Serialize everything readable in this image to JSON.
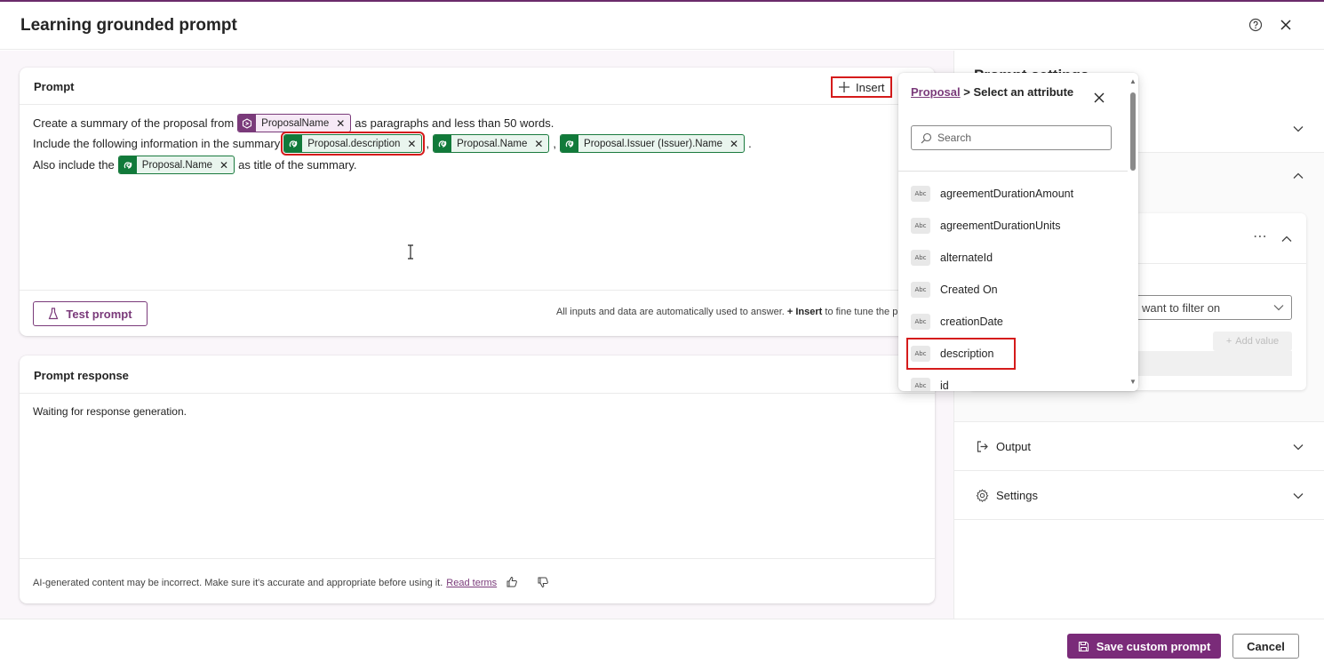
{
  "dialog": {
    "title": "Learning grounded prompt",
    "help_icon": "help-icon",
    "close_icon": "close-icon"
  },
  "prompt": {
    "section_title": "Prompt",
    "insert_label": "Insert",
    "line1": {
      "before": "Create a summary of the proposal from",
      "chip": "ProposalName",
      "after": "as paragraphs and less than 50 words."
    },
    "line2": {
      "before": "Include the following information in the summary",
      "chips": [
        "Proposal.description",
        "Proposal.Name",
        "Proposal.Issuer (Issuer).Name"
      ],
      "separators": [
        ",",
        ",",
        "."
      ]
    },
    "line3": {
      "before": "Also include the",
      "chip": "Proposal.Name",
      "after": "as title of the summary."
    },
    "test_button": "Test prompt",
    "footnote_pre": "All inputs and data are automatically used to answer.",
    "footnote_bold": "+ Insert",
    "footnote_post": "to fine tune the pro"
  },
  "response": {
    "section_title": "Prompt response",
    "waiting": "Waiting for response generation.",
    "disclaimer": "AI-generated content may be incorrect. Make sure it's accurate and appropriate before using it.",
    "read_terms": "Read terms"
  },
  "right_panel": {
    "heading_partial": "Prompt settings",
    "filter_placeholder": "want to filter on",
    "add_value": "Add value",
    "output_label": "Output",
    "settings_label": "Settings"
  },
  "popup": {
    "breadcrumb_link": "Proposal",
    "breadcrumb_sep": ">",
    "title_rest": "Select an attribute",
    "search_placeholder": "Search",
    "attribute_icon_text": "Abc",
    "attributes": [
      "agreementDurationAmount",
      "agreementDurationUnits",
      "alternateId",
      "Created On",
      "creationDate",
      "description",
      "id"
    ],
    "highlighted": "description"
  },
  "footer": {
    "save": "Save custom prompt",
    "cancel": "Cancel"
  },
  "colors": {
    "brand": "#7a2b79",
    "highlight": "#d51b1b",
    "chip_green": "#117a3a"
  }
}
